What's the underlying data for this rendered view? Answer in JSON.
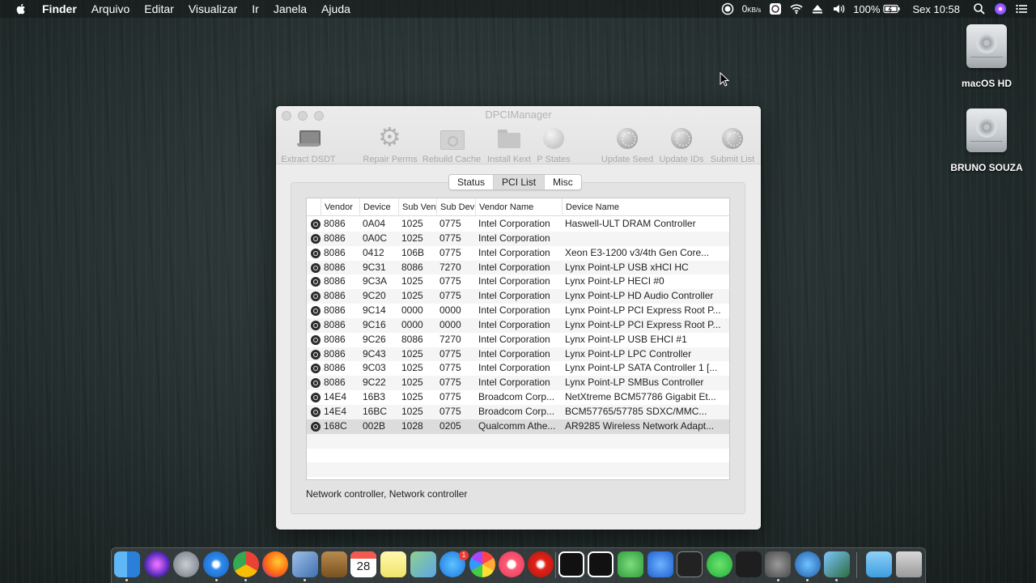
{
  "menubar": {
    "items": [
      "Finder",
      "Arquivo",
      "Editar",
      "Visualizar",
      "Ir",
      "Janela",
      "Ajuda"
    ],
    "status": {
      "net_speed": "0",
      "net_unit": "KB/s",
      "battery": "100%",
      "clock": "Sex 10:58"
    }
  },
  "desktop": {
    "icons": [
      {
        "label": "macOS HD",
        "icon": "hard-drive-icon"
      },
      {
        "label": "BRUNO SOUZA",
        "icon": "hard-drive-icon"
      }
    ]
  },
  "window": {
    "title": "DPCIManager",
    "toolbar": [
      {
        "label": "Extract DSDT",
        "icon": "laptop-icon"
      },
      {
        "label": "Repair Perms",
        "icon": "gear-icon"
      },
      {
        "label": "Rebuild Cache",
        "icon": "cache-box-icon"
      },
      {
        "label": "Install Kext",
        "icon": "folder-icon"
      },
      {
        "label": "P States",
        "icon": "sphere-icon"
      },
      {
        "label": "Update Seed",
        "icon": "globe-icon"
      },
      {
        "label": "Update IDs",
        "icon": "globe-icon"
      },
      {
        "label": "Submit List",
        "icon": "globe-icon"
      }
    ],
    "tabs": [
      {
        "label": "Status",
        "active": false
      },
      {
        "label": "PCI List",
        "active": true
      },
      {
        "label": "Misc",
        "active": false
      }
    ],
    "columns": [
      "Vendor",
      "Device",
      "Sub Ven",
      "Sub Dev",
      "Vendor Name",
      "Device Name"
    ],
    "rows": [
      [
        "8086",
        "0A04",
        "1025",
        "0775",
        "Intel Corporation",
        "Haswell-ULT DRAM Controller"
      ],
      [
        "8086",
        "0A0C",
        "1025",
        "0775",
        "Intel Corporation",
        ""
      ],
      [
        "8086",
        "0412",
        "106B",
        "0775",
        "Intel Corporation",
        "Xeon E3-1200 v3/4th Gen Core..."
      ],
      [
        "8086",
        "9C31",
        "8086",
        "7270",
        "Intel Corporation",
        "Lynx Point-LP USB xHCI HC"
      ],
      [
        "8086",
        "9C3A",
        "1025",
        "0775",
        "Intel Corporation",
        "Lynx Point-LP HECI #0"
      ],
      [
        "8086",
        "9C20",
        "1025",
        "0775",
        "Intel Corporation",
        "Lynx Point-LP HD Audio Controller"
      ],
      [
        "8086",
        "9C14",
        "0000",
        "0000",
        "Intel Corporation",
        "Lynx Point-LP PCI Express Root P..."
      ],
      [
        "8086",
        "9C16",
        "0000",
        "0000",
        "Intel Corporation",
        "Lynx Point-LP PCI Express Root P..."
      ],
      [
        "8086",
        "9C26",
        "8086",
        "7270",
        "Intel Corporation",
        "Lynx Point-LP USB EHCI #1"
      ],
      [
        "8086",
        "9C43",
        "1025",
        "0775",
        "Intel Corporation",
        "Lynx Point-LP LPC Controller"
      ],
      [
        "8086",
        "9C03",
        "1025",
        "0775",
        "Intel Corporation",
        "Lynx Point-LP SATA Controller 1 [..."
      ],
      [
        "8086",
        "9C22",
        "1025",
        "0775",
        "Intel Corporation",
        "Lynx Point-LP SMBus Controller"
      ],
      [
        "14E4",
        "16B3",
        "1025",
        "0775",
        "Broadcom Corp...",
        "NetXtreme BCM57786 Gigabit Et..."
      ],
      [
        "14E4",
        "16BC",
        "1025",
        "0775",
        "Broadcom Corp...",
        "BCM57765/57785 SDXC/MMC..."
      ],
      [
        "168C",
        "002B",
        "1028",
        "0205",
        "Qualcomm Athe...",
        "AR9285 Wireless Network Adapt..."
      ]
    ],
    "selected_row": 14,
    "status_text": "Network controller, Network controller"
  },
  "dock": {
    "calendar_day": "28",
    "appstore_badge": "1",
    "apps": [
      "finder",
      "siri",
      "launchpad",
      "safari",
      "chrome",
      "firefox",
      "preview",
      "notes-book",
      "calendar",
      "stickies",
      "maps",
      "app-store",
      "photos",
      "itunes",
      "vidiot",
      "audio-app-1",
      "audio-app-2",
      "android-app",
      "audio-app-3",
      "unity",
      "whatsapp",
      "downloader",
      "system-preferences",
      "browser",
      "disk-utility",
      "folder",
      "trash"
    ]
  }
}
